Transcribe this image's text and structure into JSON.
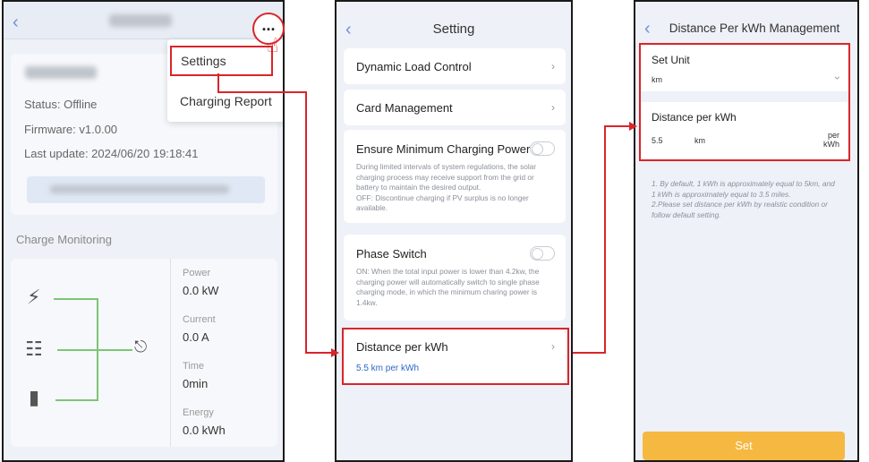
{
  "phone1": {
    "more_glyph": "...",
    "menu": {
      "settings": "Settings",
      "charging_report": "Charging Report"
    },
    "device": {
      "status": "Status: Offline",
      "firmware": "Firmware: v1.0.00",
      "last_update": "Last update: 2024/06/20 19:18:41"
    },
    "monitoring_title": "Charge Monitoring",
    "metrics": [
      {
        "label": "Power",
        "value": "0.0 kW"
      },
      {
        "label": "Current",
        "value": "0.0 A"
      },
      {
        "label": "Time",
        "value": "0min"
      },
      {
        "label": "Energy",
        "value": "0.0 kWh"
      }
    ],
    "icons": [
      "grid-tower-icon",
      "solar-panel-icon",
      "battery-icon",
      "charger-icon"
    ]
  },
  "phone2": {
    "title": "Setting",
    "items": {
      "dynamic_load": "Dynamic Load Control",
      "card_mgmt": "Card Management",
      "ensure_min": "Ensure Minimum Charging Power",
      "ensure_min_desc": "During limited intervals of system regulations, the solar charging process may receive support from the grid or battery to maintain the desired output.\nOFF:  Discontinue charging if PV surplus is no longer available.",
      "phase_switch": "Phase Switch",
      "phase_switch_desc": "ON:  When the total input power is lower than 4.2kw, the charging power will automatically switch to single phase charging mode, in which the minimum charing power is 1.4kw.",
      "distance": "Distance per kWh",
      "distance_value": "5.5 km per kWh"
    },
    "toggles": {
      "ensure_min": false,
      "phase_switch": false
    }
  },
  "phone3": {
    "title": "Distance Per kWh Management",
    "set_unit_label": "Set Unit",
    "unit_value": "km",
    "distance_label": "Distance per kWh",
    "distance_value": "5.5",
    "distance_unit": "km",
    "per_unit": "per\nkWh",
    "notes": "1. By default, 1 kWh is approximately equal to 5km, and 1 kWh is approximately equal to 3.5 miles.\n2.Please set distance per kWh by realstic condition or follow default setting.",
    "set_button": "Set"
  },
  "colors": {
    "highlight": "#d9252a",
    "accent_blue": "#2d66c9",
    "button": "#f5b840",
    "flow_line": "#7cc576"
  }
}
